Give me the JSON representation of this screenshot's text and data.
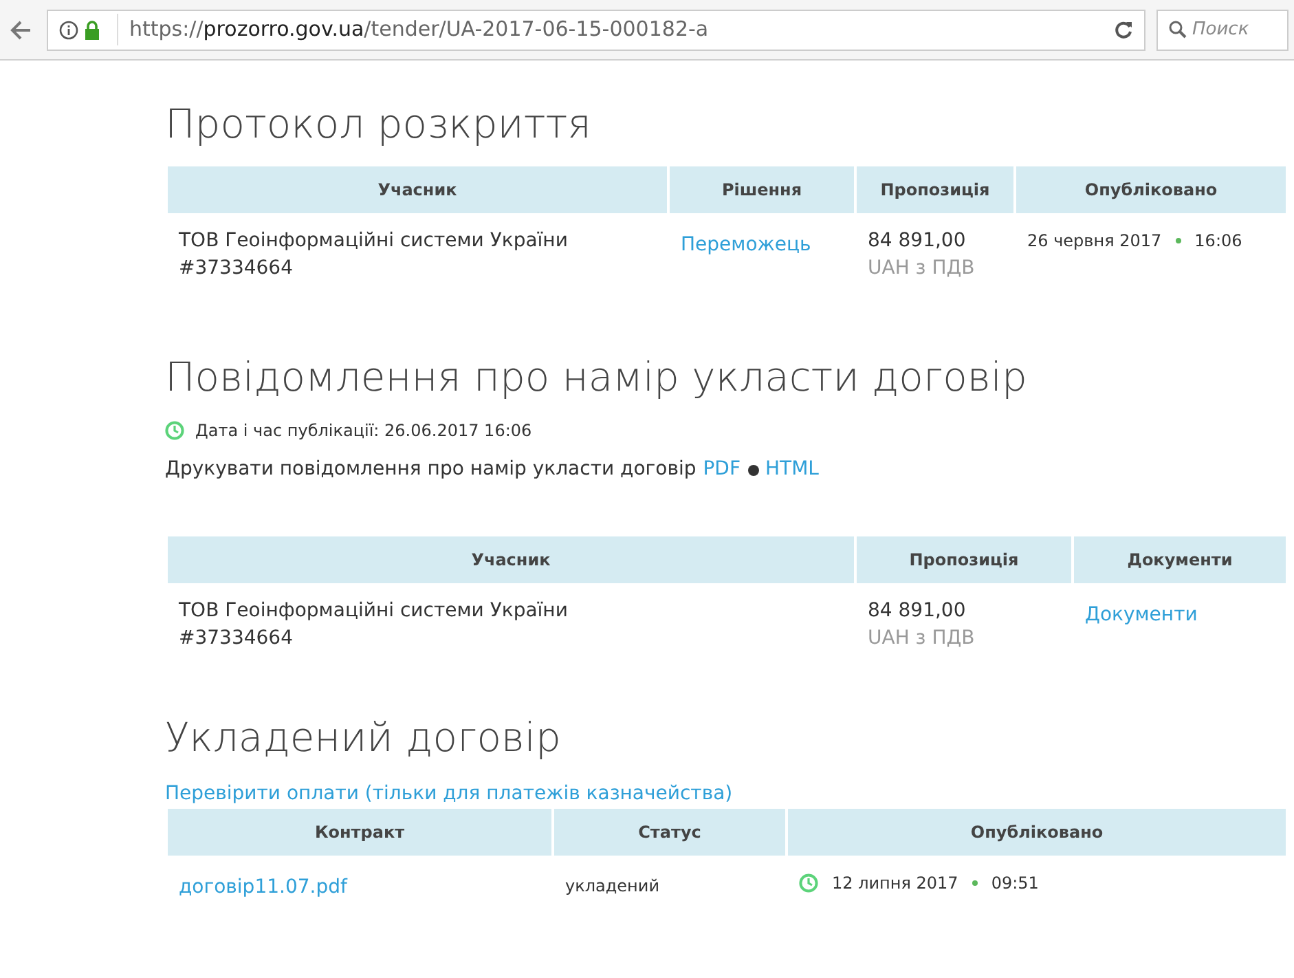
{
  "browser": {
    "url_parts": [
      {
        "text": "https://",
        "kind": "dim"
      },
      {
        "text": "prozorro.gov.ua",
        "kind": "host"
      },
      {
        "text": "/tender/UA-2017-06-15-000182-a",
        "kind": "dim"
      }
    ],
    "search_placeholder": "Поиск"
  },
  "opening_protocol": {
    "title": "Протокол розкриття",
    "table": {
      "columns": [
        {
          "label": "Учасник"
        },
        {
          "label": "Рішення"
        },
        {
          "label": "Пропозиція"
        },
        {
          "label": "Опубліковано"
        }
      ],
      "rows": [
        [
          {
            "kind": "text",
            "text": "ТОВ Геоінформаційні системи України #37334664"
          },
          {
            "kind": "link",
            "text": "Переможець"
          },
          {
            "kind": "amount",
            "text": "84 891,00",
            "note": "UAH з ПДВ"
          },
          {
            "kind": "date",
            "date": "26 червня 2017",
            "time": "16:06"
          }
        ]
      ]
    }
  },
  "intent_notice": {
    "title": "Повідомлення про намір укласти договір",
    "published_label": "Дата і час публікації: 26.06.2017 16:06",
    "print_label": "Друкувати повідомлення про намір укласти договір",
    "print_links": [
      "PDF",
      "HTML"
    ],
    "table": {
      "columns": [
        {
          "label": "Учасник"
        },
        {
          "label": "Пропозиція"
        },
        {
          "label": "Документи"
        }
      ],
      "rows": [
        [
          {
            "kind": "text",
            "text": "ТОВ Геоінформаційні системи України #37334664"
          },
          {
            "kind": "amount",
            "text": "84 891,00",
            "note": "UAH з ПДВ"
          },
          {
            "kind": "link",
            "text": "Документи"
          }
        ]
      ]
    }
  },
  "contract": {
    "title": "Укладений договір",
    "check_link": "Перевірити оплати (тільки для платежів казначейства)",
    "table": {
      "columns": [
        {
          "label": "Контракт"
        },
        {
          "label": "Статус"
        },
        {
          "label": "Опубліковано"
        }
      ],
      "rows": [
        [
          {
            "kind": "link",
            "text": "договір11.07.pdf"
          },
          {
            "kind": "small",
            "text": "укладений"
          },
          {
            "kind": "clockdate",
            "date": "12 липня 2017",
            "time": "09:51"
          }
        ]
      ]
    }
  }
}
